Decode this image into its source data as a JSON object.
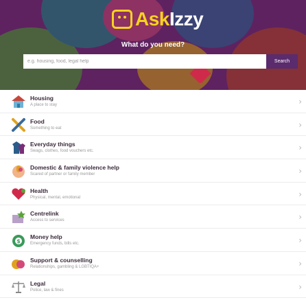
{
  "brand": {
    "prefix": "Ask",
    "suffix": "Izzy"
  },
  "hero": {
    "prompt": "What do you need?"
  },
  "search": {
    "placeholder": "e.g. housing, food, legal help",
    "button_label": "Search"
  },
  "categories": [
    {
      "title": "Housing",
      "subtitle": "A place to stay",
      "icon": "house-icon"
    },
    {
      "title": "Food",
      "subtitle": "Something to eat",
      "icon": "cutlery-icon"
    },
    {
      "title": "Everyday things",
      "subtitle": "Swags, clothes, food vouchers etc.",
      "icon": "clothes-icon"
    },
    {
      "title": "Domestic & family violence help",
      "subtitle": "Scared of partner or family member",
      "icon": "hand-icon"
    },
    {
      "title": "Health",
      "subtitle": "Physical, mental, emotional",
      "icon": "heart-icon"
    },
    {
      "title": "Centrelink",
      "subtitle": "Access to services",
      "icon": "centrelink-icon"
    },
    {
      "title": "Money help",
      "subtitle": "Emergency funds, bills etc.",
      "icon": "money-icon"
    },
    {
      "title": "Support & counselling",
      "subtitle": "Relationships, gambling & LGBTIQA+",
      "icon": "support-icon"
    },
    {
      "title": "Legal",
      "subtitle": "Police, law & fines",
      "icon": "scales-icon"
    }
  ],
  "colors": {
    "hero": "#7a2e76",
    "logo_yellow": "#f6d21f",
    "search_button": "#5a2b6d"
  }
}
